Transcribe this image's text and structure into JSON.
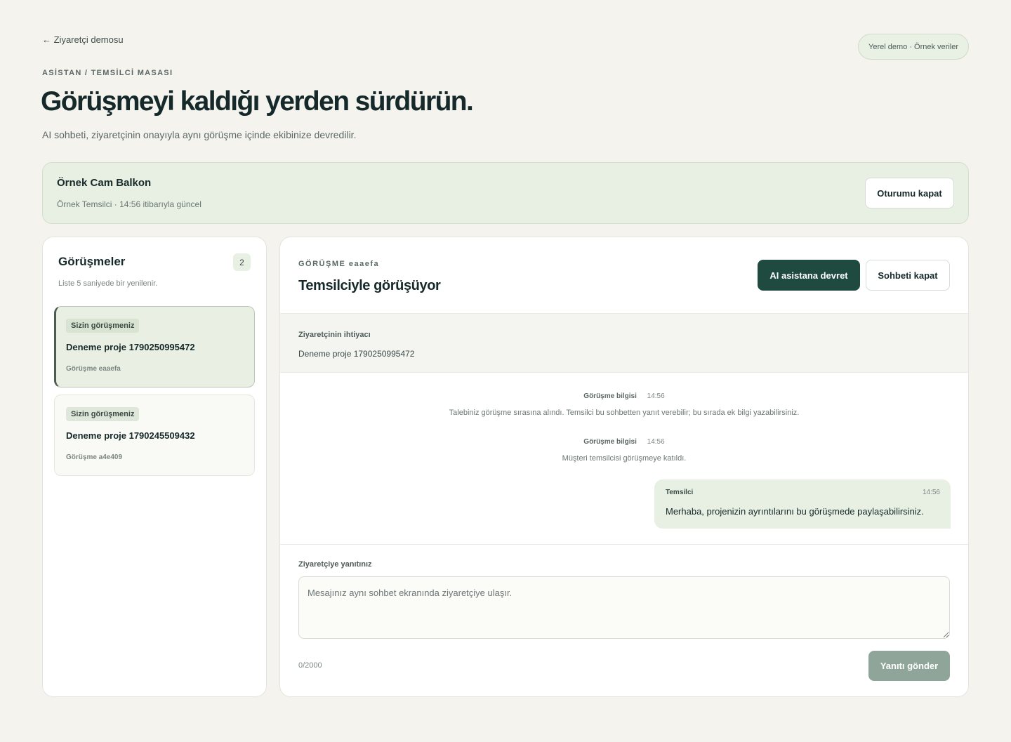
{
  "nav": {
    "back_label": "← Ziyaretçi demosu"
  },
  "demo_badge": "Yerel demo · Örnek veriler",
  "header": {
    "eyebrow": "ASİSTAN / TEMSİLCİ MASASI",
    "title": "Görüşmeyi kaldığı yerden sürdürün.",
    "subtitle": "AI sohbeti, ziyaretçinin onayıyla aynı görüşme içinde ekibinize devredilir."
  },
  "session": {
    "company": "Örnek Cam Balkon",
    "meta": "Örnek Temsilci · 14:56 itibarıyla güncel",
    "logout_label": "Oturumu kapat"
  },
  "conversations": {
    "title": "Görüşmeler",
    "count": "2",
    "hint": "Liste 5 saniyede bir yenilenir.",
    "items": [
      {
        "tag": "Sizin görüşmeniz",
        "title": "Deneme proje 1790250995472",
        "id": "Görüşme eaaefa",
        "active": true
      },
      {
        "tag": "Sizin görüşmeniz",
        "title": "Deneme proje 1790245509432",
        "id": "Görüşme a4e409",
        "active": false
      }
    ]
  },
  "chat": {
    "eyebrow": "GÖRÜŞME eaaefa",
    "title": "Temsilciyle görüşüyor",
    "handoff_label": "AI asistana devret",
    "close_label": "Sohbeti kapat",
    "need": {
      "label": "Ziyaretçinin ihtiyacı",
      "value": "Deneme proje 1790250995472"
    },
    "system_messages": [
      {
        "label": "Görüşme bilgisi",
        "time": "14:56",
        "text": "Talebiniz görüşme sırasına alındı. Temsilci bu sohbetten yanıt verebilir; bu sırada ek bilgi yazabilirsiniz."
      },
      {
        "label": "Görüşme bilgisi",
        "time": "14:56",
        "text": "Müşteri temsilcisi görüşmeye katıldı."
      }
    ],
    "agent_message": {
      "author": "Temsilci",
      "time": "14:56",
      "text": "Merhaba, projenizin ayrıntılarını bu görüşmede paylaşabilirsiniz."
    },
    "reply": {
      "label": "Ziyaretçiye yanıtınız",
      "placeholder": "Mesajınız aynı sohbet ekranında ziyaretçiye ulaşır.",
      "value": "",
      "char_count": "0/2000",
      "send_label": "Yanıtı gönder"
    }
  },
  "colors": {
    "background": "#f4f3ee",
    "primary": "#1f4a40",
    "accent_soft": "#e8efe3",
    "send_disabled": "#8fa59a"
  }
}
